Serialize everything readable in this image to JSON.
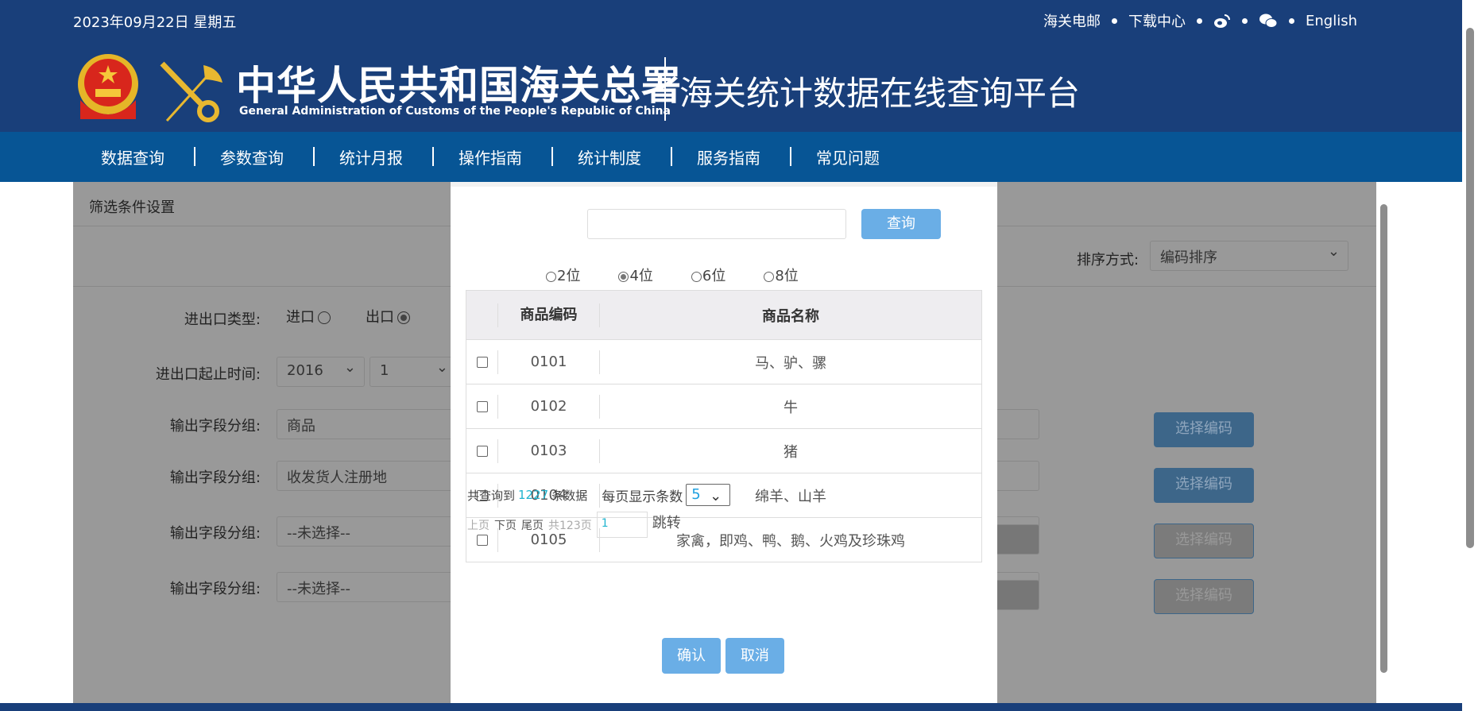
{
  "header": {
    "date": "2023年09月22日 星期五",
    "links": [
      "海关电邮",
      "下载中心",
      "English"
    ],
    "icons": [
      "weibo-icon",
      "wechat-icon"
    ],
    "org_cn": "中华人民共和国海关总署",
    "org_en": "General Administration of Customs of the People's Republic of China",
    "platform": "海关统计数据在线查询平台"
  },
  "nav": [
    "数据查询",
    "参数查询",
    "统计月报",
    "操作指南",
    "统计制度",
    "服务指南",
    "常见问题"
  ],
  "panel": {
    "title": "筛选条件设置",
    "sort_label": "排序方式:",
    "sort_value": "编码排序",
    "trade_type_label": "进出口类型:",
    "trade_types": [
      {
        "label": "进口",
        "checked": false
      },
      {
        "label": "出口",
        "checked": true
      }
    ],
    "time_label": "进出口起止时间:",
    "year": "2016",
    "month": "1",
    "groups": [
      {
        "label": "输出字段分组:",
        "value": "商品",
        "enabled": true,
        "button": "选择编码"
      },
      {
        "label": "输出字段分组:",
        "value": "收发货人注册地",
        "enabled": true,
        "button": "选择编码"
      },
      {
        "label": "输出字段分组:",
        "value": "--未选择--",
        "enabled": false,
        "button": "选择编码"
      },
      {
        "label": "输出字段分组:",
        "value": "--未选择--",
        "enabled": false,
        "button": "选择编码"
      }
    ]
  },
  "modal": {
    "search_value": "",
    "query_label": "查询",
    "digit_options": [
      {
        "label": "2位",
        "checked": false
      },
      {
        "label": "4位",
        "checked": true
      },
      {
        "label": "6位",
        "checked": false
      },
      {
        "label": "8位",
        "checked": false
      }
    ],
    "columns": [
      "商品编码",
      "商品名称"
    ],
    "rows": [
      {
        "code": "0101",
        "name": "马、驴、骡"
      },
      {
        "code": "0102",
        "name": "牛"
      },
      {
        "code": "0103",
        "name": "猪"
      },
      {
        "code": "0104",
        "name": "绵羊、山羊"
      },
      {
        "code": "0105",
        "name": "家禽，即鸡、鸭、鹅、火鸡及珍珠鸡"
      }
    ],
    "summary_prefix": "共查询到",
    "total": "1227",
    "summary_suffix": "条数据",
    "per_page_label": "每页显示条数",
    "per_page": "5",
    "pager": {
      "prev": "上页",
      "next": "下页",
      "last": "尾页",
      "total_pages": "共123页",
      "page": "1",
      "jump": "跳转"
    },
    "confirm": "确认",
    "cancel": "取消"
  }
}
